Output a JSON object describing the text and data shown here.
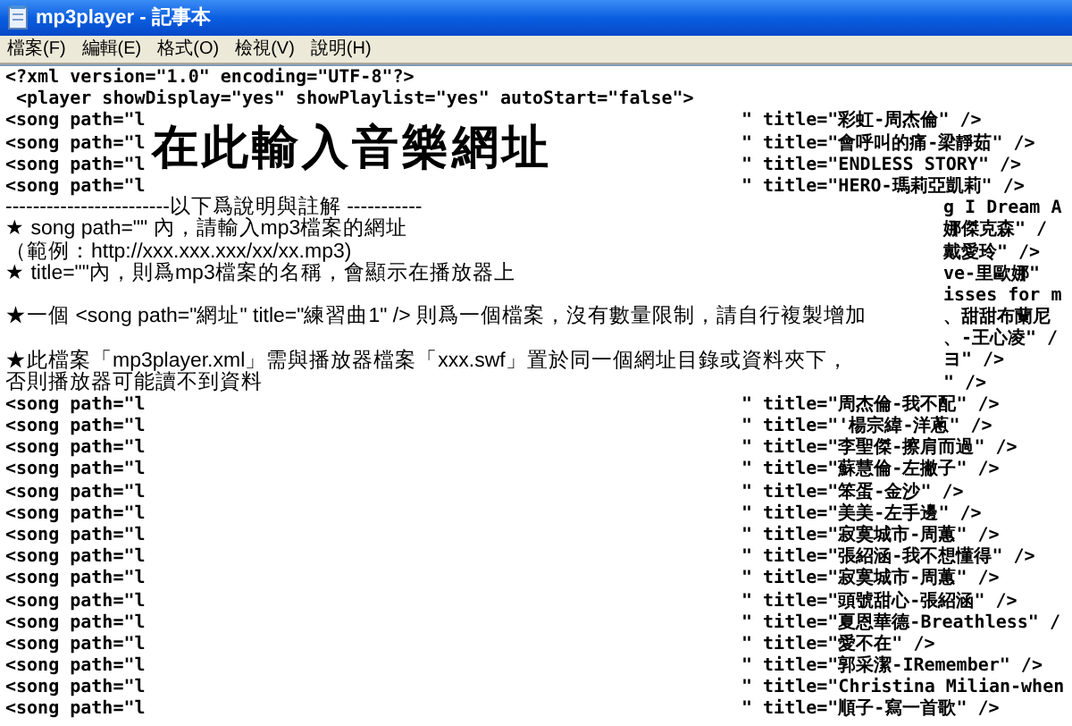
{
  "window": {
    "title": "mp3player - 記事本"
  },
  "menu": [
    "檔案(F)",
    "編輯(E)",
    "格式(O)",
    "檢視(V)",
    "說明(H)"
  ],
  "editor_lines": [
    {
      "kind": "text",
      "text": "<?xml version=\"1.0\" encoding=\"UTF-8\"?>"
    },
    {
      "kind": "text",
      "text": " <player showDisplay=\"yes\" showPlaylist=\"yes\" autoStart=\"false\">"
    },
    {
      "kind": "song",
      "path": "<song path=\"l",
      "title": "\" title=\"彩虹-周杰倫\" />"
    },
    {
      "kind": "song",
      "path": "<song path=\"l",
      "title": "\" title=\"會呼叫的痛-梁靜茹\" />"
    },
    {
      "kind": "song",
      "path": "<song path=\"l",
      "title": "\" title=\"ENDLESS STORY\" />"
    },
    {
      "kind": "song",
      "path": "<song path=\"l",
      "title": "\" title=\"HERO-瑪莉亞凱莉\" />"
    },
    {
      "kind": "fragment",
      "text": "g I Dream A"
    },
    {
      "kind": "fragment",
      "text": "娜傑克森\" /"
    },
    {
      "kind": "fragment",
      "text": "戴愛玲\" />"
    },
    {
      "kind": "fragment",
      "text": "ve-里歐娜\""
    },
    {
      "kind": "fragment",
      "text": "isses for m"
    },
    {
      "kind": "fragment",
      "text": "、甜甜布蘭尼"
    },
    {
      "kind": "fragment",
      "text": "、-王心凌\" /"
    },
    {
      "kind": "fragment",
      "text": "ヨ\" />"
    },
    {
      "kind": "fragment",
      "text": "\" />"
    },
    {
      "kind": "song",
      "path": "<song path=\"l",
      "title": "\" title=\"周杰倫-我不配\" />"
    },
    {
      "kind": "song",
      "path": "<song path=\"l",
      "title": "\" title=\"'楊宗緯-洋蔥\" />"
    },
    {
      "kind": "song",
      "path": "<song path=\"l",
      "title": "\" title=\"李聖傑-擦肩而過\" />"
    },
    {
      "kind": "song",
      "path": "<song path=\"l",
      "title": "\" title=\"蘇慧倫-左撇子\" />"
    },
    {
      "kind": "song",
      "path": "<song path=\"l",
      "title": "\" title=\"笨蛋-金沙\" />"
    },
    {
      "kind": "song",
      "path": "<song path=\"l",
      "title": "\" title=\"美美-左手邊\" />"
    },
    {
      "kind": "song",
      "path": "<song path=\"l",
      "title": "\" title=\"寂寞城市-周蕙\" />"
    },
    {
      "kind": "song",
      "path": "<song path=\"l",
      "title": "\" title=\"張紹涵-我不想懂得\" />"
    },
    {
      "kind": "song",
      "path": "<song path=\"l",
      "title": "\" title=\"寂寞城市-周蕙\" />"
    },
    {
      "kind": "song",
      "path": "<song path=\"l",
      "title": "\" title=\"頭號甜心-張紹涵\" />"
    },
    {
      "kind": "song",
      "path": "<song path=\"l",
      "title": "\" title=\"夏恩華德-Breathless\" /"
    },
    {
      "kind": "song",
      "path": "<song path=\"l",
      "title": "\" title=\"愛不在\" />"
    },
    {
      "kind": "song",
      "path": "<song path=\"l",
      "title": "\" title=\"郭采潔-IRemember\" />"
    },
    {
      "kind": "song",
      "path": "<song path=\"l",
      "title": "\" title=\"Christina Milian-when"
    },
    {
      "kind": "song",
      "path": "<song path=\"l",
      "title": "\" title=\"順子-寫一首歌\" />"
    }
  ],
  "overlay": {
    "heading": "在此輸入音樂網址",
    "note_groups": [
      [
        "------------------------以下爲說明與註解 -----------",
        "★ song path=\"\" 內，請輸入mp3檔案的網址",
        "（範例：http://xxx.xxx.xxx/xx/xx.mp3)",
        "★ title=\"\"內，則爲mp3檔案的名稱，會顯示在播放器上"
      ],
      [
        "★一個 <song path=\"網址\" title=\"練習曲1\" /> 則爲一個檔案，沒有數量限制，請自行複製增加"
      ],
      [
        "★此檔案「mp3player.xml」需與播放器檔案「xxx.swf」置於同一個網址目錄或資料夾下，",
        "否則播放器可能讀不到資料"
      ]
    ]
  }
}
